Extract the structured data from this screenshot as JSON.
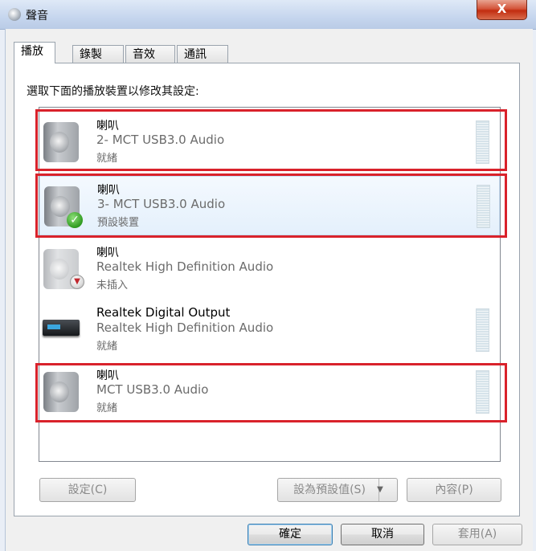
{
  "window": {
    "title": "聲音",
    "close_label": "X"
  },
  "tabs": [
    {
      "label": "播放",
      "active": true
    },
    {
      "label": "錄製",
      "active": false
    },
    {
      "label": "音效",
      "active": false
    },
    {
      "label": "通訊",
      "active": false
    }
  ],
  "instruction": "選取下面的播放裝置以修改其設定:",
  "devices": [
    {
      "name": "喇叭",
      "driver": "2- MCT USB3.0 Audio",
      "status": "就緒",
      "icon": "speaker-icon"
    },
    {
      "name": "喇叭",
      "driver": "3- MCT USB3.0 Audio",
      "status": "預設裝置",
      "icon": "speaker-icon",
      "badge": "default-check-icon",
      "selected": true
    },
    {
      "name": "喇叭",
      "driver": "Realtek High Definition Audio",
      "status": "未插入",
      "icon": "speaker-icon",
      "badge": "unplugged-icon"
    },
    {
      "name": "Realtek Digital Output",
      "driver": "Realtek High Definition Audio",
      "status": "就緒",
      "icon": "digital-output-icon"
    },
    {
      "name": "喇叭",
      "driver": "MCT USB3.0 Audio",
      "status": "就緒",
      "icon": "speaker-icon"
    }
  ],
  "buttons": {
    "configure": "設定(C)",
    "set_default": "設為預設值(S)",
    "properties": "內容(P)",
    "ok": "確定",
    "cancel": "取消",
    "apply": "套用(A)"
  },
  "colors": {
    "highlight_border": "#d9222b",
    "accent": "#3c7fb1"
  }
}
